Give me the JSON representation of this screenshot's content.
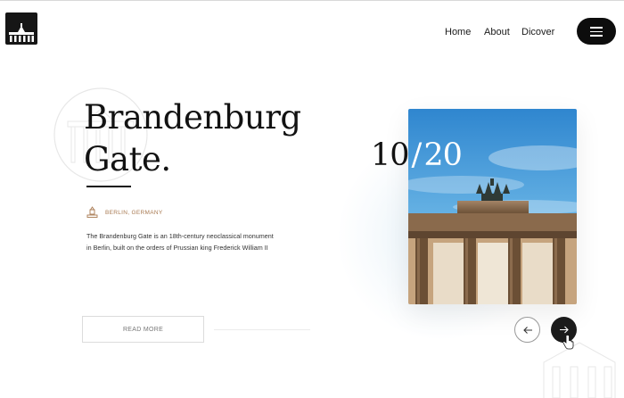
{
  "logo": {
    "icon": "gate-logo-icon"
  },
  "nav": {
    "items": [
      {
        "label": "Home"
      },
      {
        "label": "About"
      },
      {
        "label": "Dicover"
      }
    ],
    "menu_icon": "hamburger-icon"
  },
  "hero": {
    "title_line1": "Brandenburg",
    "title_line2": "Gate.",
    "location": "BERLIN, GERMANY",
    "location_icon": "monument-pin-icon",
    "description": "The Brandenburg Gate is an 18th-century neoclassical monument in Berlin, built on the orders of Prussian king Frederick William II",
    "read_more": "READ MORE"
  },
  "slider": {
    "current": "10",
    "separator": "/",
    "total": "20",
    "prev_icon": "arrow-left-icon",
    "next_icon": "arrow-right-icon"
  },
  "colors": {
    "accent": "#a87a52",
    "dark": "#111111",
    "sky": "#4a9fd8"
  }
}
